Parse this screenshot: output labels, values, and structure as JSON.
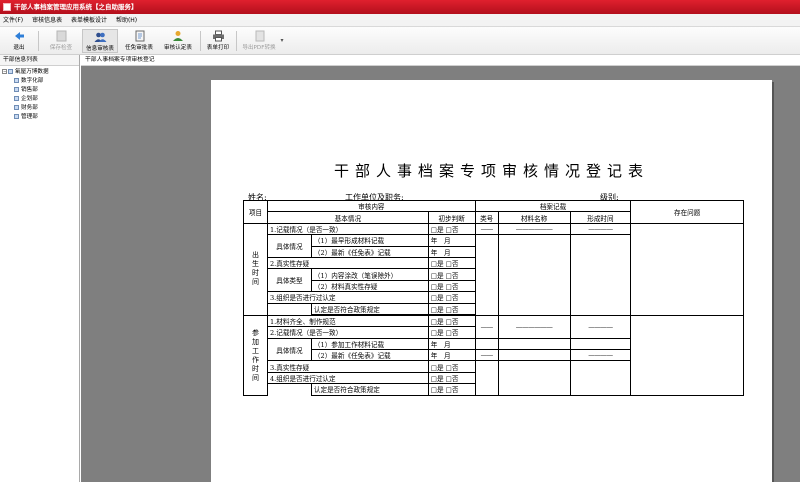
{
  "app": {
    "title": "干部人事档案管理应用系统【之自助服务】"
  },
  "menu": [
    "文件(F)",
    "审核信息表",
    "表单模板设计",
    "帮助(H)"
  ],
  "toolbar": {
    "exit": "退出",
    "save_check": "保存检查",
    "info_review": "信息审核表",
    "appoint_review": "任免审批表",
    "review_confirm": "审核认定表",
    "form_print": "表单打印",
    "export_pdf": "导出PDF转换"
  },
  "left_panel": {
    "title": "干部信息列表",
    "root": "氧屋万博数据",
    "children": [
      "数字化部",
      "销售部",
      "企划部",
      "财务部",
      "管理部"
    ]
  },
  "doc_tab": "干部人事档案专项审核登记",
  "form": {
    "title": "干部人事档案专项审核情况登记表",
    "name_label": "姓名:",
    "unit_label": "工作单位及职务:",
    "level_label": "级别:",
    "headers": {
      "item": "项目",
      "review_content": "审核内容",
      "archive_record": "档案记载",
      "issues": "存在问题",
      "basic": "基本情况",
      "initial": "初步判断",
      "category": "类号",
      "material_name": "材料名称",
      "formed_time": "形成时间"
    },
    "yes_no": "□是 □否",
    "year_month": "年　月",
    "dash_short": "——",
    "dash_long": "——————",
    "dash_mid": "————",
    "section1_label": "出生时间",
    "section1": {
      "r1": "1.记载情况（是否一致）",
      "r2_group": "具体情况",
      "r2a": "（1）最早形成材料记载",
      "r2b": "（2）最新《任免表》记载",
      "r3": "2.真实性存疑",
      "r4_group": "具体类型",
      "r4a": "（1）内容涂改（笔误除外）",
      "r4b": "（2）材料真实性存疑",
      "r5": "3.组织是否进行过认定",
      "r6": "认定是否符合政策规定"
    },
    "section2_label": "参加工作时间",
    "section2": {
      "r1": "1.材料齐全、制作规范",
      "r2": "2.记载情况（是否一致）",
      "r3_group": "具体情况",
      "r3a": "（1）参加工作材料记载",
      "r3b": "（2）最新《任免表》记载",
      "r4": "3.真实性存疑",
      "r5": "4.组织是否进行过认定",
      "r6": "认定是否符合政策规定"
    }
  },
  "colors": {
    "titlebar": "#c8141f",
    "viewer_bg": "#7f7f7f"
  }
}
